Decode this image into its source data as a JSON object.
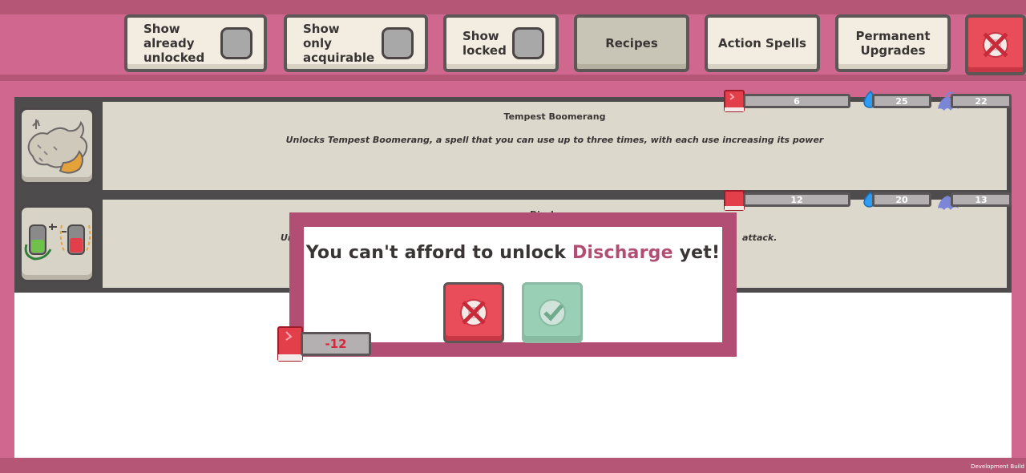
{
  "toolbar": {
    "show_unlocked": {
      "label": "Show already unlocked",
      "checked": false
    },
    "show_acquirable": {
      "label": "Show only acquirable",
      "checked": false
    },
    "show_locked": {
      "label": "Show locked",
      "checked": false
    },
    "tabs": [
      {
        "label": "Recipes",
        "active": true
      },
      {
        "label": "Action Spells",
        "active": false
      },
      {
        "label": "Permanent Upgrades",
        "active": false
      }
    ]
  },
  "unlocks": [
    {
      "title": "Tempest Boomerang",
      "description": "Unlocks Tempest Boomerang, a spell that you can use up to three times, with each use increasing its power",
      "costs": {
        "book": "6",
        "droplet": "25",
        "wisp": "22"
      }
    },
    {
      "title": "Discharge",
      "description_left": "Ur",
      "description_right": "attack.",
      "costs": {
        "book": "12",
        "droplet": "20",
        "wisp": "13"
      }
    }
  ],
  "dialog": {
    "message_prefix": "You can't afford to unlock",
    "item_name": "Discharge",
    "message_suffix": "yet!",
    "deficit": "-12"
  },
  "footer": {
    "build_label": "Development Build"
  },
  "colors": {
    "background": "#d0678f",
    "accent": "#b24e74",
    "cancel_red": "#ea4d5a",
    "confirm_green": "#99cfb4",
    "deficit_red": "#d22a3c"
  },
  "icons": [
    "book-icon",
    "droplet-icon",
    "wisp-icon",
    "close-icon",
    "checkmark-icon"
  ]
}
